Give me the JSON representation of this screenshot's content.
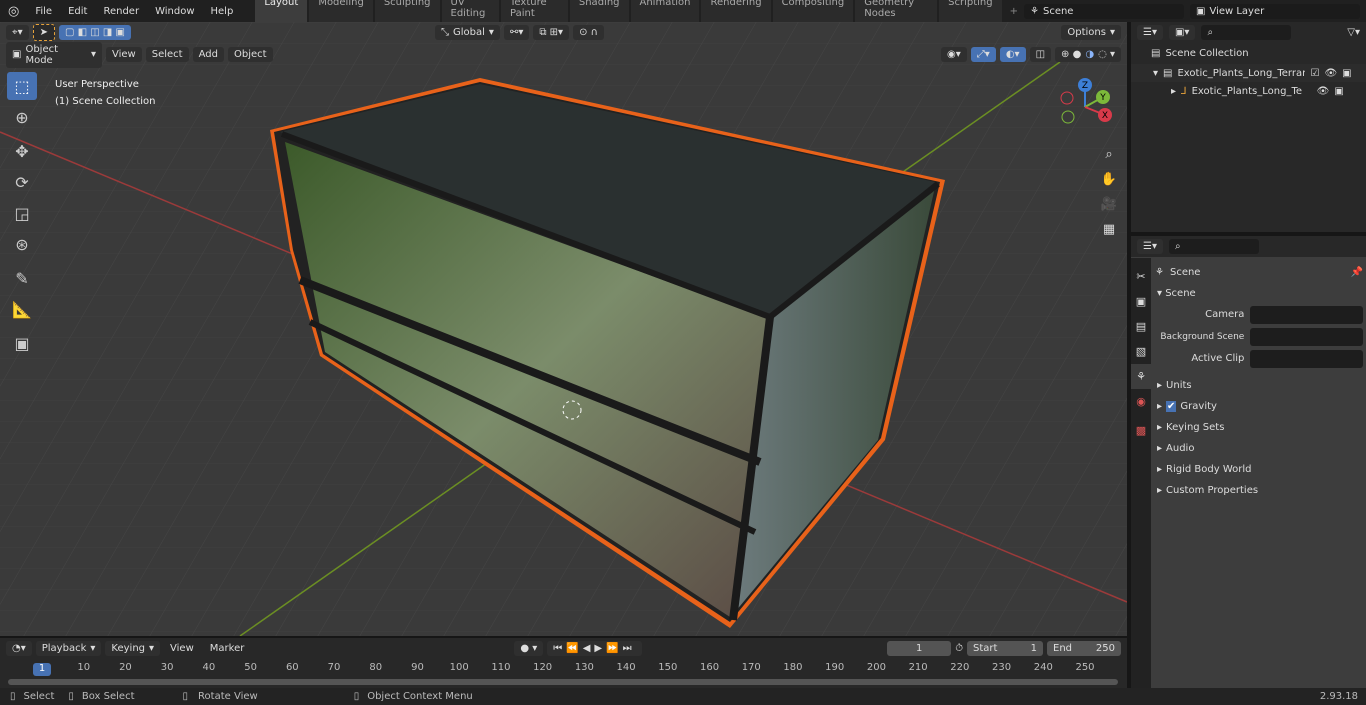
{
  "menu": [
    "File",
    "Edit",
    "Render",
    "Window",
    "Help"
  ],
  "workspaces": [
    "Layout",
    "Modeling",
    "Sculpting",
    "UV Editing",
    "Texture Paint",
    "Shading",
    "Animation",
    "Rendering",
    "Compositing",
    "Geometry Nodes",
    "Scripting"
  ],
  "active_workspace": "Layout",
  "scene": "Scene",
  "view_layer": "View Layer",
  "viewport": {
    "mode": "Object Mode",
    "menus": [
      "View",
      "Select",
      "Add",
      "Object"
    ],
    "orientation": "Global",
    "options": "Options",
    "info_line1": "User Perspective",
    "info_line2": "(1) Scene Collection",
    "axes": [
      "X",
      "Y",
      "Z"
    ],
    "selection_color": "#e8621a",
    "x_axis_color": "#9b3a3a",
    "y_axis_color": "#6b8e23"
  },
  "outliner": {
    "root": "Scene Collection",
    "collection": "Exotic_Plants_Long_Terrarium",
    "object": "Exotic_Plants_Long_Terra"
  },
  "properties": {
    "context": "Scene",
    "section": "Scene",
    "camera_label": "Camera",
    "background_label": "Background Scene",
    "clip_label": "Active Clip",
    "panels": [
      "Units",
      "Gravity",
      "Keying Sets",
      "Audio",
      "Rigid Body World",
      "Custom Properties"
    ]
  },
  "timeline": {
    "menus": [
      "Playback",
      "Keying",
      "View",
      "Marker"
    ],
    "current_frame": "1",
    "start_label": "Start",
    "start": "1",
    "end_label": "End",
    "end": "250",
    "ticks": [
      "10",
      "20",
      "30",
      "40",
      "50",
      "60",
      "70",
      "80",
      "90",
      "100",
      "110",
      "120",
      "130",
      "140",
      "150",
      "160",
      "170",
      "180",
      "190",
      "200",
      "210",
      "220",
      "230",
      "240",
      "250"
    ],
    "playhead": "1"
  },
  "status": {
    "select": "Select",
    "box_select": "Box Select",
    "rotate": "Rotate View",
    "context_menu": "Object Context Menu",
    "version": "2.93.18"
  }
}
